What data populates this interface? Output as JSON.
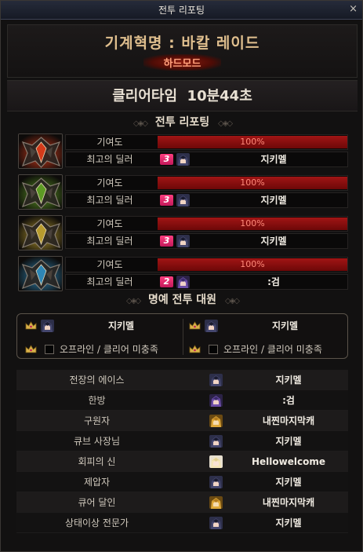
{
  "window": {
    "title": "전투 리포팅",
    "close": "×"
  },
  "raid": {
    "name": "기계혁명 : 바칼 레이드",
    "mode": "하드모드"
  },
  "clear": {
    "text": "클리어타임  10분44초"
  },
  "reporting": {
    "heading": "전투 리포팅"
  },
  "labels": {
    "contribution": "기여도",
    "best_dealer": "최고의 딜러"
  },
  "parties": [
    {
      "color": "#d23a1a",
      "contribution_percent": 100,
      "contribution_text": "100%",
      "rank": "3",
      "dealer": "지키멜",
      "avatar": "dark-haired"
    },
    {
      "color": "#5d9a24",
      "contribution_percent": 100,
      "contribution_text": "100%",
      "rank": "3",
      "dealer": "지키멜",
      "avatar": "dark-haired"
    },
    {
      "color": "#b79b2e",
      "contribution_percent": 100,
      "contribution_text": "100%",
      "rank": "3",
      "dealer": "지키멜",
      "avatar": "dark-haired"
    },
    {
      "color": "#2e86b5",
      "contribution_percent": 100,
      "contribution_text": "100%",
      "rank": "2",
      "dealer": ":검",
      "avatar": "purple-haired"
    }
  ],
  "honor": {
    "heading": "명예 전투 대원",
    "members": [
      {
        "name": "지키멜"
      },
      {
        "name": "지키멜"
      }
    ],
    "offline_label": "오프라인 / 클리어 미충족"
  },
  "awards": [
    {
      "title": "전장의 에이스",
      "name": "지키멜",
      "avatar": "dark-haired"
    },
    {
      "title": "한방",
      "name": ":검",
      "avatar": "purple-haired"
    },
    {
      "title": "구원자",
      "name": "내찐마지막캐",
      "avatar": "golden"
    },
    {
      "title": "큐브 사장님",
      "name": "지키멜",
      "avatar": "dark-haired"
    },
    {
      "title": "회피의 신",
      "name": "Hellowelcome",
      "avatar": "blonde"
    },
    {
      "title": "제압자",
      "name": "지키멜",
      "avatar": "dark-haired"
    },
    {
      "title": "큐어 달인",
      "name": "내찐마지막캐",
      "avatar": "golden"
    },
    {
      "title": "상태이상 전문가",
      "name": "지키멜",
      "avatar": "dark-haired"
    }
  ]
}
